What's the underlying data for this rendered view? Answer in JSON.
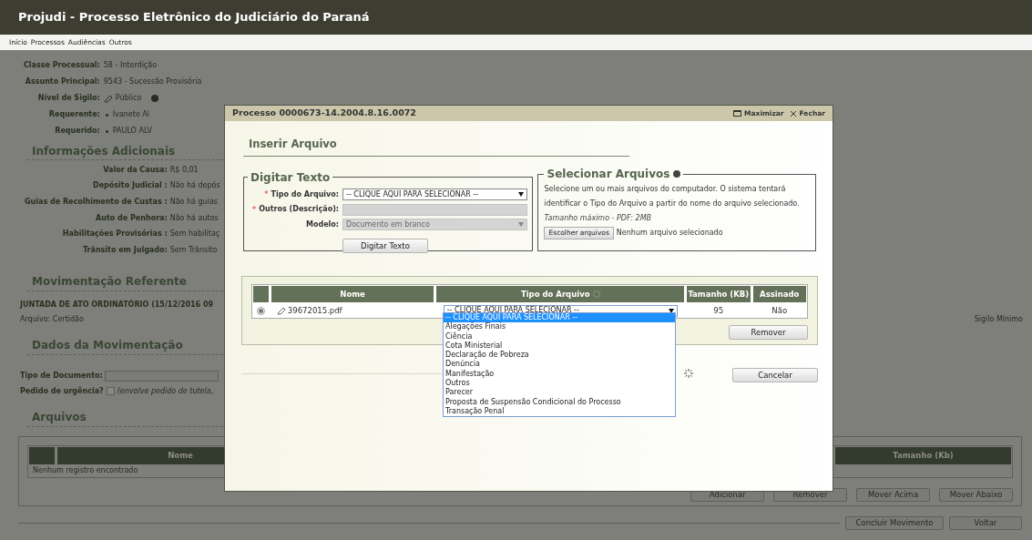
{
  "header": {
    "title": "Projudi - Processo Eletrônico do Judiciário do Paraná"
  },
  "menu": [
    "Início",
    "Processos",
    "Audiências",
    "Outros"
  ],
  "process_info": [
    {
      "kind": "text",
      "label": "Classe Processual:",
      "value": "58 - Interdição"
    },
    {
      "kind": "text",
      "label": "Assunto Principal:",
      "value": "9543 - Sucessão Provisória"
    },
    {
      "kind": "sigilo",
      "label": "Nível de Sigilo:",
      "value": "Público"
    },
    {
      "kind": "party",
      "label": "Requerente:",
      "value": "Ivanete Al"
    },
    {
      "kind": "party",
      "label": "Requerido:",
      "value": "PAULO ALV"
    }
  ],
  "additional": {
    "heading": "Informações Adicionais",
    "rows": [
      {
        "label": "Valor da Causa:",
        "value": "R$ 0,01"
      },
      {
        "label": "Depósito Judicial :",
        "value": "Não há depós"
      },
      {
        "label": "Guias de Recolhimento de Custas :",
        "value": "Não há guias"
      },
      {
        "label": "Auto de Penhora:",
        "value": "Não há autos"
      },
      {
        "label": "Habilitações Provisórias :",
        "value": "Sem habilitaç"
      },
      {
        "label": "Trânsito em Julgado:",
        "value": "Sem Trânsito"
      }
    ]
  },
  "movimentacao_referente": {
    "heading": "Movimentação Referente",
    "title": "JUNTADA DE ATO ORDINATÓRIO (15/12/2016 09",
    "arquivo": "Arquivo: Certidão",
    "sigilo": "Sigilo Mínimo"
  },
  "dados": {
    "heading": "Dados da Movimentação",
    "tipo_label": "Tipo de Documento:",
    "urgencia_label": "Pedido de urgência?",
    "urgencia_checked": false,
    "urgencia_note": "(envolve pedido de tutela,"
  },
  "arquivos": {
    "heading": "Arquivos",
    "columns": [
      "Nome",
      "Tamanho (Kb)"
    ],
    "empty_text": "Nenhum registro encontrado",
    "buttons": [
      "Adicionar",
      "Remover",
      "Mover Acima",
      "Mover Abaixo"
    ]
  },
  "footer_buttons": [
    "Concluir Movimento",
    "Voltar"
  ],
  "modal": {
    "title": "Processo 0000673-14.2004.8.16.0072",
    "maximize": "Maximizar",
    "close": "Fechar",
    "heading": "Inserir Arquivo",
    "digitar": {
      "legend": "Digitar Texto",
      "fields": [
        {
          "kind": "select",
          "mark": "*",
          "label": "Tipo do Arquivo:",
          "value": "-- CLIQUE AQUI PARA SELECIONAR --",
          "disabled": false
        },
        {
          "kind": "input",
          "mark": "*",
          "label": "Outros (Descrição):",
          "disabled": true
        },
        {
          "kind": "select",
          "label": "Modelo:",
          "value": "Documento em branco",
          "disabled": true
        }
      ],
      "button": "Digitar Texto"
    },
    "selecionar": {
      "legend": "Selecionar Arquivos",
      "description": "Selecione um ou mais arquivos do computador. O sistema tentará identificar o Tipo do Arquivo a partir do nome do arquivo selecionado.",
      "max_size": "Tamanho máximo - PDF: 2MB",
      "choose_button": "Escolher arquivos",
      "no_file": "Nenhum arquivo selecionado"
    },
    "files_table": {
      "columns": [
        "Nome",
        "Tipo do Arquivo",
        "Tamanho (KB)",
        "Assinado"
      ],
      "rows": [
        {
          "selected": true,
          "name": "39672015.pdf",
          "type": "-- CLIQUE AQUI PARA SELECIONAR --",
          "size": "95",
          "signed": "Não"
        }
      ]
    },
    "remove_button": "Remover",
    "cancel_button": "Cancelar",
    "dropdown": {
      "options": [
        {
          "label": "-- CLIQUE AQUI PARA SELECIONAR --",
          "selected": true
        },
        {
          "label": "Alegações Finais",
          "selected": false
        },
        {
          "label": "Ciência",
          "selected": false
        },
        {
          "label": "Cota Ministerial",
          "selected": false
        },
        {
          "label": "Declaração de Pobreza",
          "selected": false
        },
        {
          "label": "Denúncia",
          "selected": false
        },
        {
          "label": "Manifestação",
          "selected": false
        },
        {
          "label": "Outros",
          "selected": false
        },
        {
          "label": "Parecer",
          "selected": false
        },
        {
          "label": "Proposta de Suspensão Condicional do Processo",
          "selected": false
        },
        {
          "label": "Transação Penal",
          "selected": false
        }
      ]
    }
  }
}
